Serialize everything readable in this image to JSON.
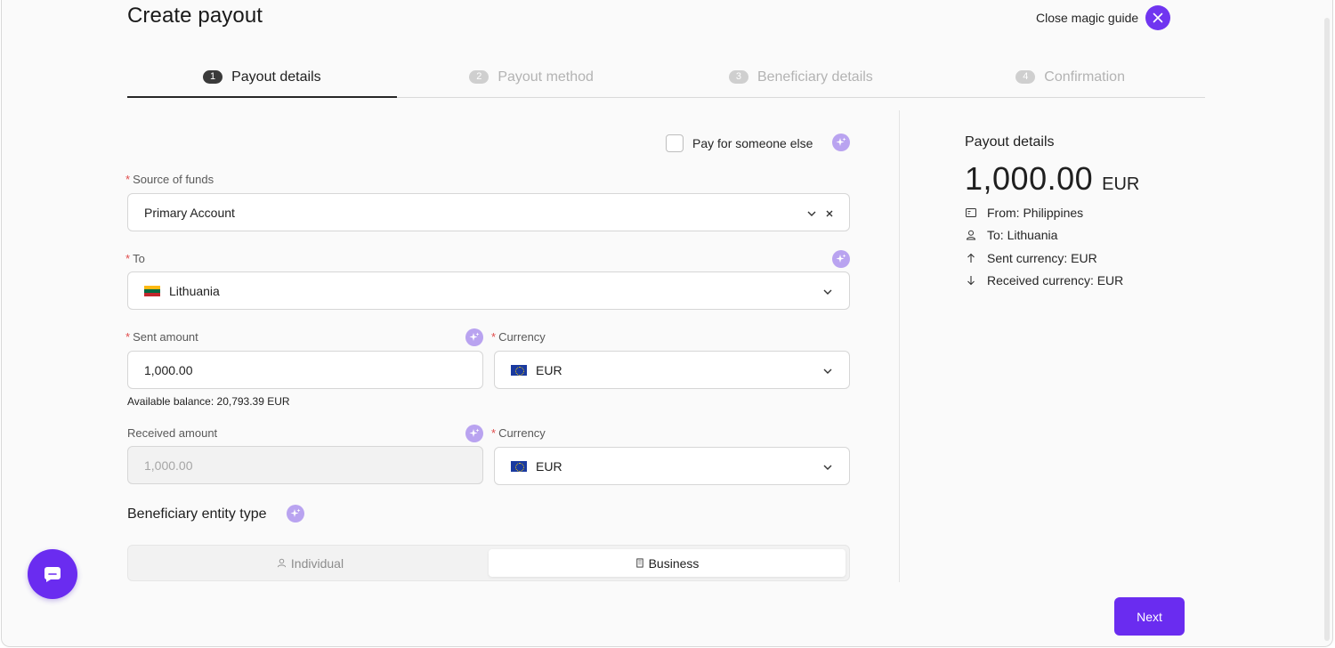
{
  "header": {
    "title": "Create payout",
    "magic_guide_label": "Close magic guide"
  },
  "steps": [
    {
      "num": "1",
      "label": "Payout details",
      "active": true
    },
    {
      "num": "2",
      "label": "Payout method",
      "active": false
    },
    {
      "num": "3",
      "label": "Beneficiary details",
      "active": false
    },
    {
      "num": "4",
      "label": "Confirmation",
      "active": false
    }
  ],
  "form": {
    "pay_for_someone_else": "Pay for someone else",
    "source_of_funds": {
      "label": "Source of funds",
      "value": "Primary Account"
    },
    "to": {
      "label": "To",
      "value": "Lithuania"
    },
    "sent_amount": {
      "label": "Sent amount",
      "value": "1,000.00"
    },
    "sent_currency": {
      "label": "Currency",
      "value": "EUR"
    },
    "available_balance": "Available balance: 20,793.39 EUR",
    "received_amount": {
      "label": "Received amount",
      "value": "1,000.00"
    },
    "received_currency": {
      "label": "Currency",
      "value": "EUR"
    },
    "entity_type": {
      "title": "Beneficiary entity type",
      "options": [
        "Individual",
        "Business"
      ],
      "selected": "Business"
    }
  },
  "summary": {
    "title": "Payout details",
    "amount": "1,000.00",
    "currency": "EUR",
    "items": [
      {
        "icon": "card-icon",
        "text": "From: Philippines"
      },
      {
        "icon": "user-icon",
        "text": "To: Lithuania"
      },
      {
        "icon": "arrow-up-icon",
        "text": "Sent currency: EUR"
      },
      {
        "icon": "arrow-down-icon",
        "text": "Received currency: EUR"
      }
    ]
  },
  "actions": {
    "next_label": "Next"
  },
  "colors": {
    "accent": "#6a2cf0",
    "sparkle": "#b9a3f0"
  }
}
